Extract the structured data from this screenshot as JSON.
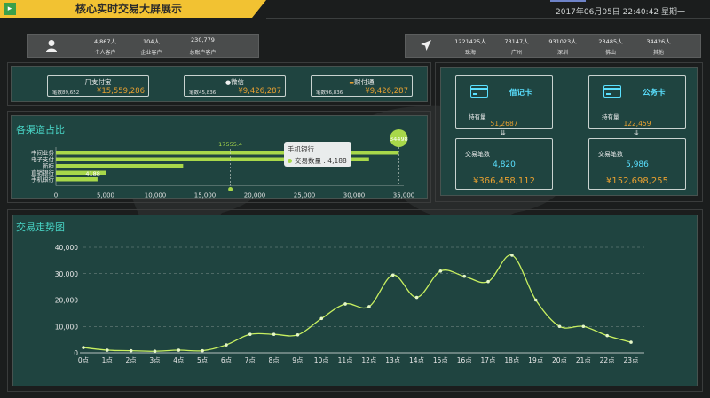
{
  "header": {
    "title": "核心实时交易大屏展示",
    "datetime": "2017年06月05日 22:40:42 星期一",
    "accent_color": "#f2c232"
  },
  "customer_stats": [
    {
      "value": "4,867人",
      "label": "个人客户"
    },
    {
      "value": "104人",
      "label": "企业客户"
    },
    {
      "value": "230,779",
      "label": "总账户客户"
    }
  ],
  "region_stats": [
    {
      "value": "1221425人",
      "label": "珠海"
    },
    {
      "value": "73147人",
      "label": "广州"
    },
    {
      "value": "931023人",
      "label": "深圳"
    },
    {
      "value": "23485人",
      "label": "佛山"
    },
    {
      "value": "34426人",
      "label": "其他"
    }
  ],
  "payments": [
    {
      "name": "支付宝",
      "count": "笔数89,652",
      "amount": "¥15,559,286",
      "icon": "alipay-icon"
    },
    {
      "name": "微信",
      "count": "笔数45,836",
      "amount": "¥9,426,287",
      "icon": "wechat-icon"
    },
    {
      "name": "财付通",
      "count": "笔数96,836",
      "amount": "¥9,426,287",
      "icon": "tenpay-icon"
    }
  ],
  "cards": [
    {
      "name": "借记卡",
      "hold_label": "持有量",
      "hold_value": "51,2687",
      "txn_label": "交易笔数",
      "txn_count": "4,820",
      "txn_amount": "¥366,458,112"
    },
    {
      "name": "公务卡",
      "hold_label": "持有量",
      "hold_value": "122,459",
      "txn_label": "交易笔数",
      "txn_count": "5,986",
      "txn_amount": "¥152,698,255"
    }
  ],
  "channel_panel": {
    "title": "各渠道占比",
    "tooltip_title": "手机银行",
    "tooltip_text": "交易数量 : 4,188",
    "max_label": "34498",
    "mid_label": "17555.4",
    "bar_label": "4188"
  },
  "trend_panel": {
    "title": "交易走势图"
  },
  "chart_data": [
    {
      "type": "bar",
      "orientation": "horizontal",
      "categories": [
        "中间业务",
        "电子支付",
        "新柜",
        "直销银行",
        "手机银行"
      ],
      "values": [
        34498,
        31500,
        12800,
        5000,
        4188
      ],
      "xlim": [
        0,
        35000
      ],
      "xticks": [
        "0",
        "5,000",
        "10,000",
        "15,000",
        "20,000",
        "25,000",
        "30,000",
        "35,000"
      ],
      "annotations": [
        {
          "label": "34498",
          "value": 34498
        },
        {
          "label": "17555.4",
          "value": 17555.4
        }
      ],
      "color": "#a8d84a"
    },
    {
      "type": "line",
      "categories": [
        "0点",
        "1点",
        "2点",
        "3点",
        "4点",
        "5点",
        "6点",
        "7点",
        "8点",
        "9点",
        "10点",
        "11点",
        "12点",
        "13点",
        "14点",
        "15点",
        "16点",
        "17点",
        "18点",
        "19点",
        "20点",
        "21点",
        "22点",
        "23点"
      ],
      "values": [
        2000,
        1000,
        800,
        600,
        1000,
        800,
        3000,
        7000,
        7000,
        6800,
        13000,
        18500,
        17500,
        29500,
        21000,
        31000,
        29000,
        27000,
        37000,
        20000,
        10000,
        10000,
        6500,
        4000
      ],
      "ylim": [
        0,
        40000
      ],
      "yticks": [
        "0",
        "10,000",
        "20,000",
        "30,000",
        "40,000"
      ],
      "grid": true,
      "color": "#c8f060"
    }
  ]
}
